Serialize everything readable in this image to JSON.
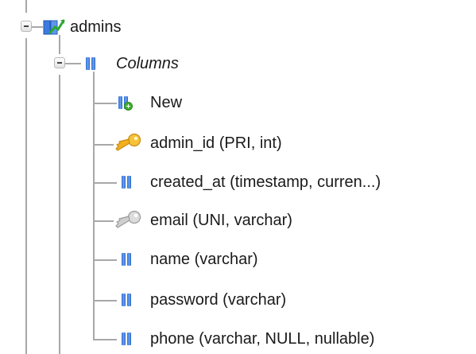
{
  "tree": {
    "database": {
      "label": "admins",
      "icon": "database-icon",
      "expanded": true
    },
    "columns_group": {
      "label": "Columns",
      "icon": "columns-icon",
      "expanded": true
    },
    "items": [
      {
        "label": "New",
        "icon": "new-column-icon"
      },
      {
        "label": "admin_id (PRI, int)",
        "icon": "primary-key-icon"
      },
      {
        "label": "created_at (timestamp, curren...)",
        "icon": "column-icon"
      },
      {
        "label": "email (UNI, varchar)",
        "icon": "unique-key-icon"
      },
      {
        "label": "name (varchar)",
        "icon": "column-icon"
      },
      {
        "label": "password (varchar)",
        "icon": "column-icon"
      },
      {
        "label": "phone (varchar, NULL, nullable)",
        "icon": "column-icon"
      }
    ]
  },
  "colors": {
    "connector": "#a8a8a8",
    "column_icon_blue": "#2f6fd4",
    "primary_key_gold": "#f2b01e",
    "unique_key_gray": "#c8c8c8",
    "new_badge_green": "#3fae2f"
  }
}
